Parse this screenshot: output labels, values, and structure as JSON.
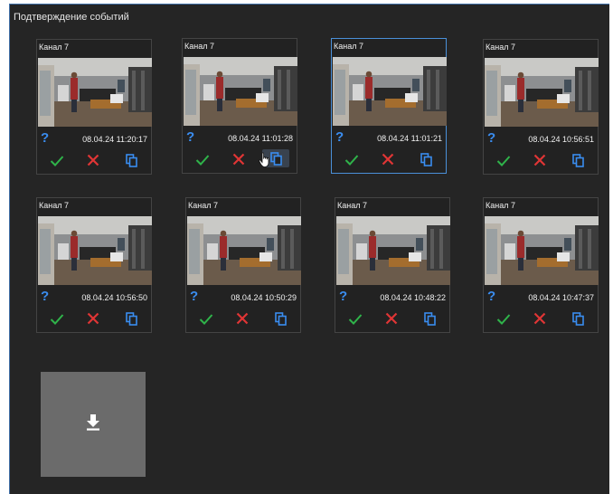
{
  "panel": {
    "title": "Подтверждение событий"
  },
  "cards": [
    {
      "channel": "Канал 7",
      "status_icon": "?",
      "timestamp": "08.04.24 11:20:17",
      "selected": false,
      "hovered_action": ""
    },
    {
      "channel": "Канал 7",
      "status_icon": "?",
      "timestamp": "08.04.24 11:01:28",
      "selected": false,
      "hovered_action": "copy"
    },
    {
      "channel": "Канал 7",
      "status_icon": "?",
      "timestamp": "08.04.24 11:01:21",
      "selected": true,
      "hovered_action": ""
    },
    {
      "channel": "Канал 7",
      "status_icon": "?",
      "timestamp": "08.04.24 10:56:51",
      "selected": false,
      "hovered_action": ""
    },
    {
      "channel": "Канал 7",
      "status_icon": "?",
      "timestamp": "08.04.24 10:56:50",
      "selected": false,
      "hovered_action": ""
    },
    {
      "channel": "Канал 7",
      "status_icon": "?",
      "timestamp": "08.04.24 10:50:29",
      "selected": false,
      "hovered_action": ""
    },
    {
      "channel": "Канал 7",
      "status_icon": "?",
      "timestamp": "08.04.24 10:48:22",
      "selected": false,
      "hovered_action": ""
    },
    {
      "channel": "Канал 7",
      "status_icon": "?",
      "timestamp": "08.04.24 10:47:37",
      "selected": false,
      "hovered_action": ""
    }
  ],
  "actions": {
    "confirm_icon": "check-icon",
    "reject_icon": "cross-icon",
    "copy_icon": "copy-icon"
  },
  "download": {
    "icon": "download-icon"
  },
  "colors": {
    "background": "#252525",
    "accent": "#3a8df0",
    "confirm": "#2fb34a",
    "reject": "#e03535",
    "selected_border": "#4a90d9"
  }
}
